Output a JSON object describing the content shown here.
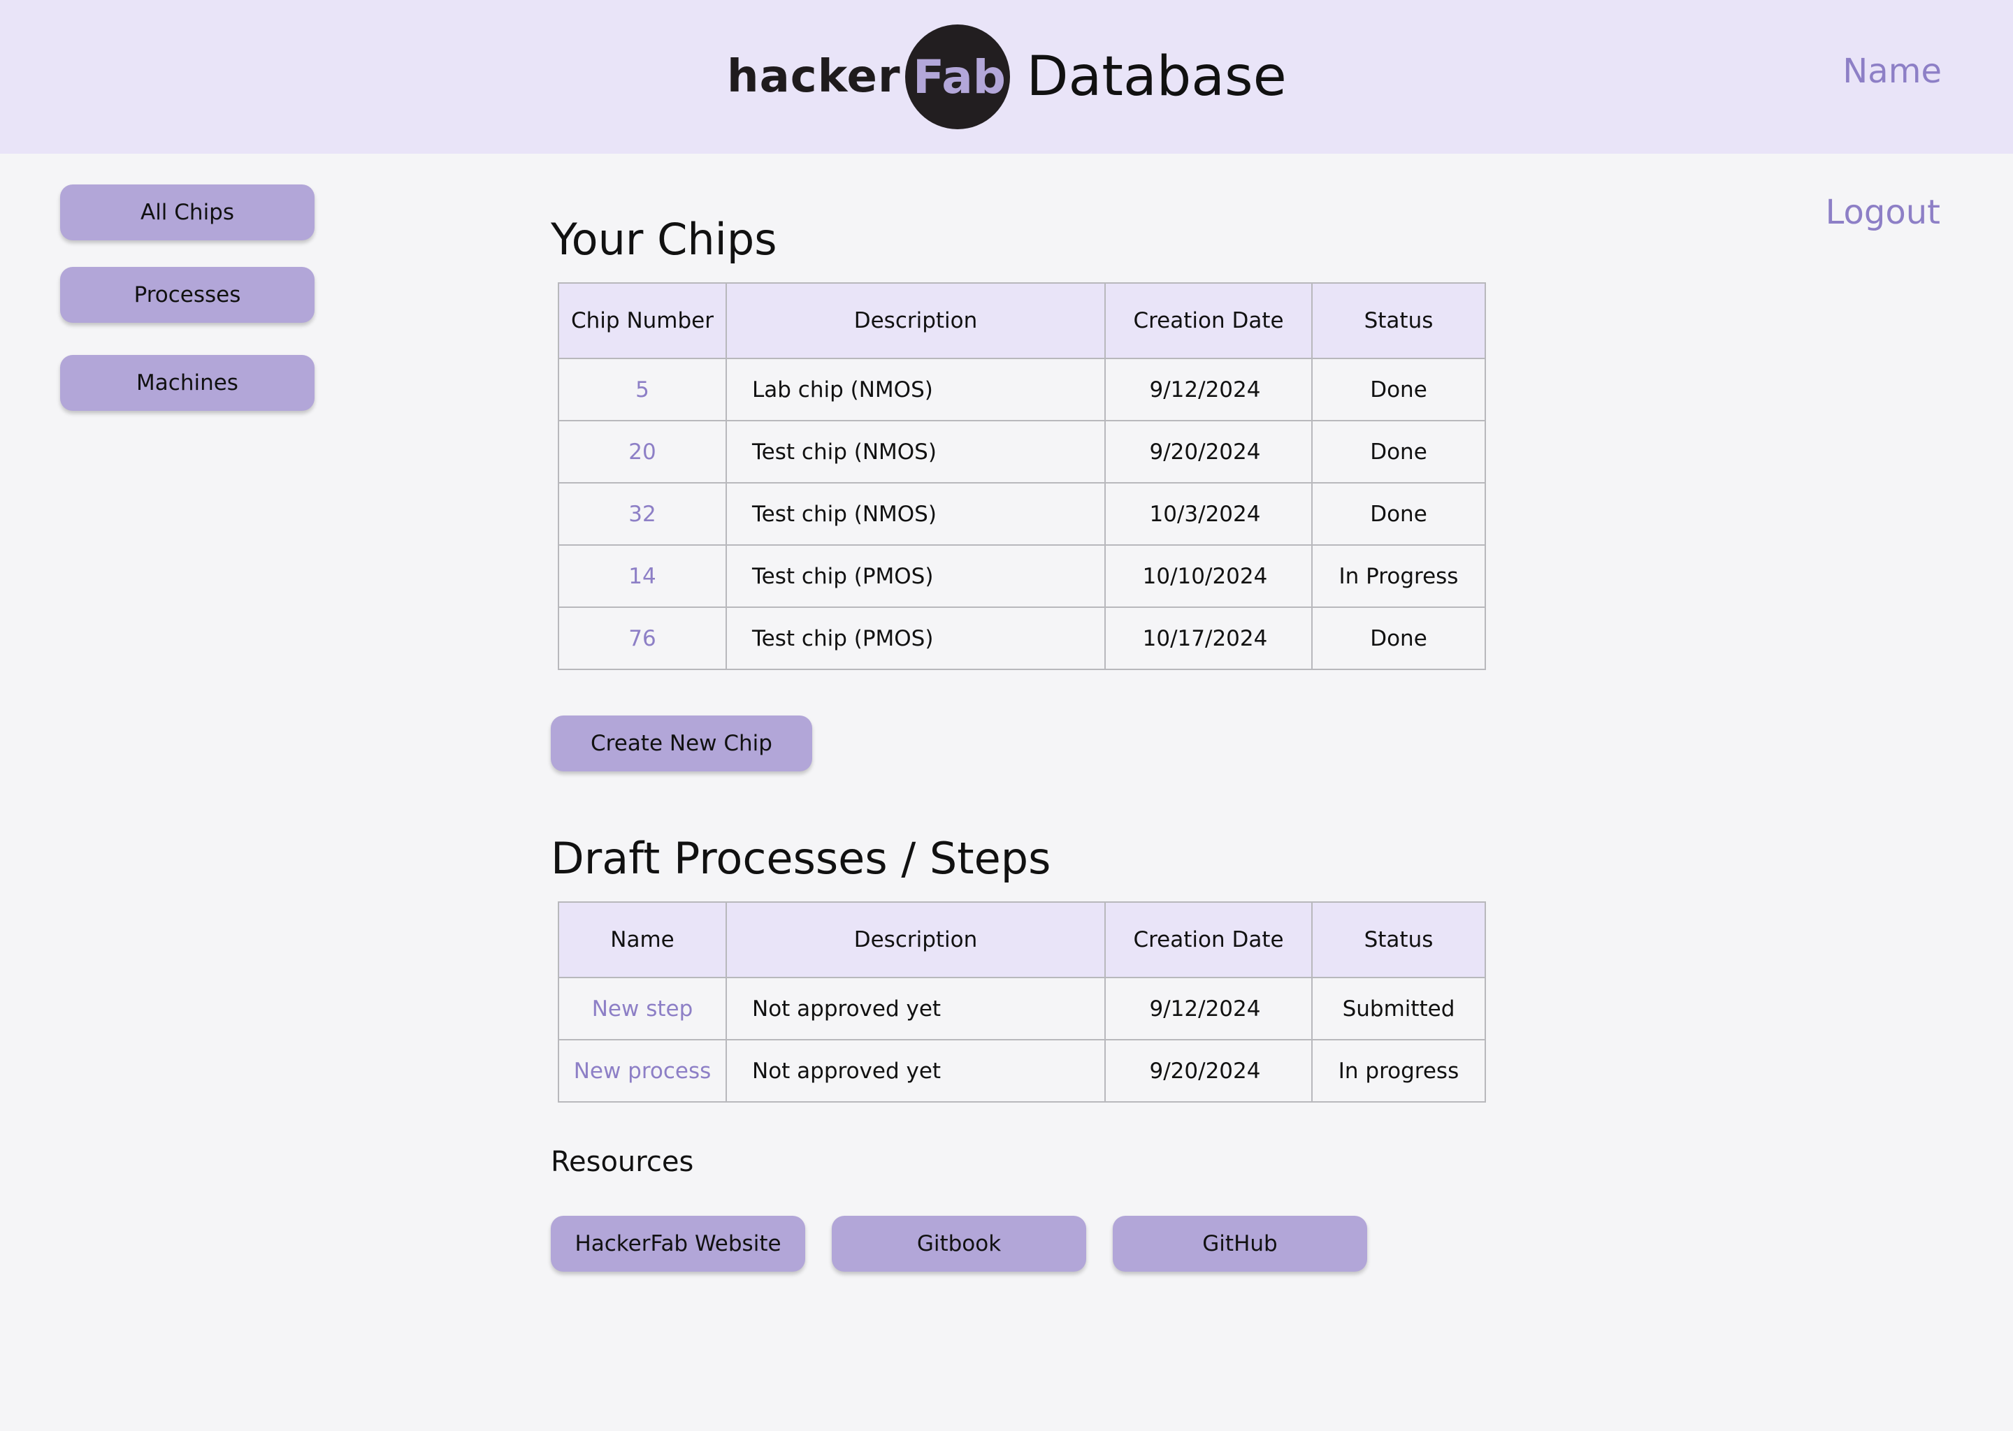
{
  "header": {
    "logo_hacker": "hacker",
    "logo_fab": "Fab",
    "logo_suffix": "Database",
    "user_name": "Name"
  },
  "sidebar": {
    "items": [
      {
        "label": "All Chips"
      },
      {
        "label": "Processes"
      },
      {
        "label": "Machines"
      }
    ]
  },
  "logout_label": "Logout",
  "chips": {
    "title": "Your Chips",
    "columns": [
      "Chip Number",
      "Description",
      "Creation Date",
      "Status"
    ],
    "rows": [
      {
        "number": "5",
        "description": "Lab chip (NMOS)",
        "date": "9/12/2024",
        "status": "Done"
      },
      {
        "number": "20",
        "description": "Test chip (NMOS)",
        "date": "9/20/2024",
        "status": "Done"
      },
      {
        "number": "32",
        "description": "Test chip (NMOS)",
        "date": "10/3/2024",
        "status": "Done"
      },
      {
        "number": "14",
        "description": "Test chip (PMOS)",
        "date": "10/10/2024",
        "status": "In Progress"
      },
      {
        "number": "76",
        "description": "Test chip (PMOS)",
        "date": "10/17/2024",
        "status": "Done"
      }
    ],
    "create_button": "Create New Chip"
  },
  "drafts": {
    "title": "Draft Processes / Steps",
    "columns": [
      "Name",
      "Description",
      "Creation Date",
      "Status"
    ],
    "rows": [
      {
        "name": "New step",
        "description": "Not approved yet",
        "date": "9/12/2024",
        "status": "Submitted"
      },
      {
        "name": "New process",
        "description": "Not approved yet",
        "date": "9/20/2024",
        "status": "In progress"
      }
    ]
  },
  "resources": {
    "label": "Resources",
    "links": [
      {
        "label": "HackerFab Website"
      },
      {
        "label": "Gitbook"
      },
      {
        "label": "GitHub"
      }
    ]
  },
  "colors": {
    "header_bg": "#e9e4f8",
    "accent": "#8d7fc6",
    "button_bg": "#b2a6d8",
    "page_bg": "#f5f5f7"
  }
}
